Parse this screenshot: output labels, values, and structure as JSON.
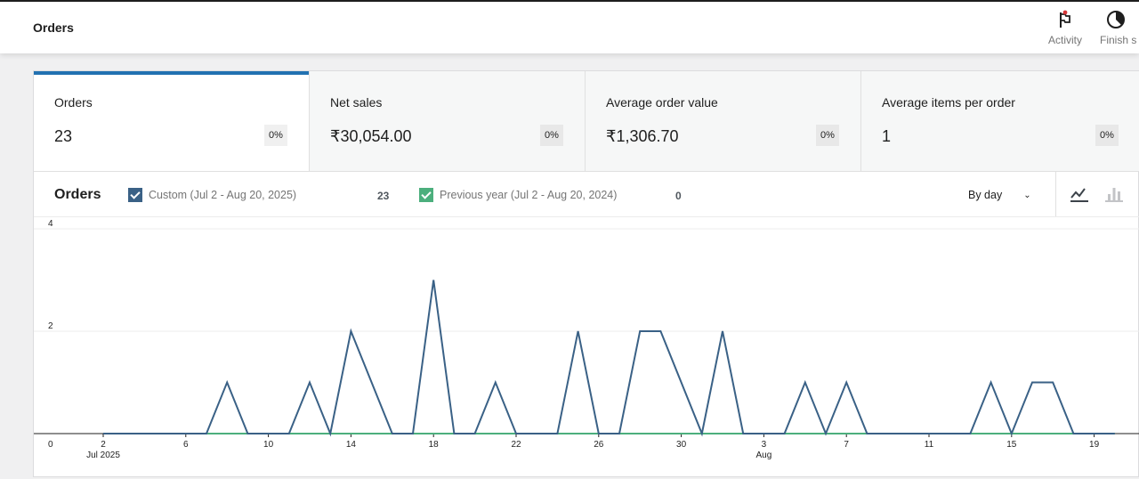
{
  "header": {
    "title": "Orders",
    "activity_label": "Activity",
    "finish_label": "Finish s"
  },
  "kpis": [
    {
      "label": "Orders",
      "value": "23",
      "delta": "0%"
    },
    {
      "label": "Net sales",
      "value": "₹30,054.00",
      "delta": "0%"
    },
    {
      "label": "Average order value",
      "value": "₹1,306.70",
      "delta": "0%"
    },
    {
      "label": "Average items per order",
      "value": "1",
      "delta": "0%"
    }
  ],
  "chart_header": {
    "title": "Orders",
    "legend": [
      {
        "name": "Custom (Jul 2 - Aug 20, 2025)",
        "total": "23",
        "color": "#3a6186"
      },
      {
        "name": "Previous year (Jul 2 - Aug 20, 2024)",
        "total": "0",
        "color": "#4caf7d"
      }
    ],
    "interval": "By day"
  },
  "colors": {
    "accent": "#2271b1",
    "series_current": "#3a6186",
    "series_previous": "#4caf7d"
  },
  "chart_data": {
    "type": "line",
    "title": "Orders",
    "x": [
      "Jul 2",
      "Jul 3",
      "Jul 4",
      "Jul 5",
      "Jul 6",
      "Jul 7",
      "Jul 8",
      "Jul 9",
      "Jul 10",
      "Jul 11",
      "Jul 12",
      "Jul 13",
      "Jul 14",
      "Jul 15",
      "Jul 16",
      "Jul 17",
      "Jul 18",
      "Jul 19",
      "Jul 20",
      "Jul 21",
      "Jul 22",
      "Jul 23",
      "Jul 24",
      "Jul 25",
      "Jul 26",
      "Jul 27",
      "Jul 28",
      "Jul 29",
      "Jul 30",
      "Jul 31",
      "Aug 1",
      "Aug 2",
      "Aug 3",
      "Aug 4",
      "Aug 5",
      "Aug 6",
      "Aug 7",
      "Aug 8",
      "Aug 9",
      "Aug 10",
      "Aug 11",
      "Aug 12",
      "Aug 13",
      "Aug 14",
      "Aug 15",
      "Aug 16",
      "Aug 17",
      "Aug 18",
      "Aug 19",
      "Aug 20"
    ],
    "series": [
      {
        "name": "Custom (Jul 2 - Aug 20, 2025)",
        "values": [
          0,
          0,
          0,
          0,
          0,
          0,
          1,
          0,
          0,
          0,
          1,
          0,
          2,
          1,
          0,
          0,
          3,
          0,
          0,
          1,
          0,
          0,
          0,
          2,
          0,
          0,
          2,
          2,
          1,
          0,
          2,
          0,
          0,
          0,
          1,
          0,
          1,
          0,
          0,
          0,
          0,
          0,
          0,
          1,
          0,
          1,
          1,
          0,
          0,
          0
        ]
      },
      {
        "name": "Previous year (Jul 2 - Aug 20, 2024)",
        "values": [
          0,
          0,
          0,
          0,
          0,
          0,
          0,
          0,
          0,
          0,
          0,
          0,
          0,
          0,
          0,
          0,
          0,
          0,
          0,
          0,
          0,
          0,
          0,
          0,
          0,
          0,
          0,
          0,
          0,
          0,
          0,
          0,
          0,
          0,
          0,
          0,
          0,
          0,
          0,
          0,
          0,
          0,
          0,
          0,
          0,
          0,
          0,
          0,
          0,
          0
        ]
      }
    ],
    "ylim": [
      0,
      4
    ],
    "y_ticks": [
      "0",
      "2",
      "4"
    ],
    "x_ticks": [
      {
        "label": "2",
        "sub": "Jul 2025",
        "index": 0
      },
      {
        "label": "6",
        "sub": "",
        "index": 4
      },
      {
        "label": "10",
        "sub": "",
        "index": 8
      },
      {
        "label": "14",
        "sub": "",
        "index": 12
      },
      {
        "label": "18",
        "sub": "",
        "index": 16
      },
      {
        "label": "22",
        "sub": "",
        "index": 20
      },
      {
        "label": "26",
        "sub": "",
        "index": 24
      },
      {
        "label": "30",
        "sub": "",
        "index": 28
      },
      {
        "label": "3",
        "sub": "Aug",
        "index": 32
      },
      {
        "label": "7",
        "sub": "",
        "index": 36
      },
      {
        "label": "11",
        "sub": "",
        "index": 40
      },
      {
        "label": "15",
        "sub": "",
        "index": 44
      },
      {
        "label": "19",
        "sub": "",
        "index": 48
      }
    ],
    "grid": true
  }
}
